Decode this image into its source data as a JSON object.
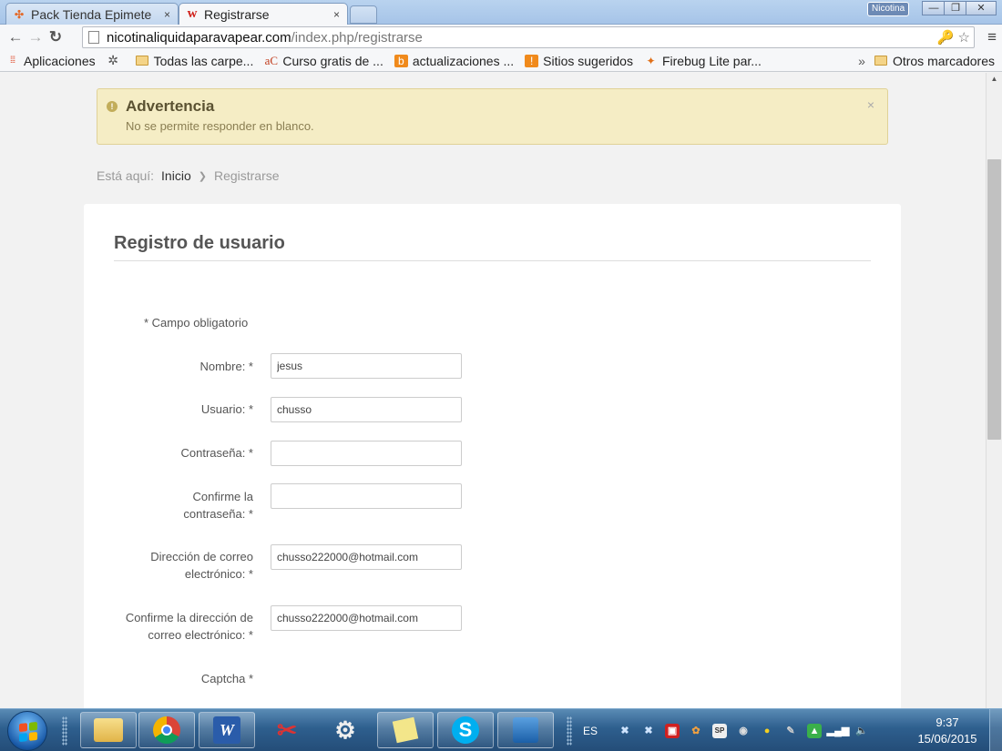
{
  "browser": {
    "tabs": [
      {
        "title": "Pack Tienda Epimete",
        "favicon": "joomla-icon",
        "active": false
      },
      {
        "title": "Registrarse",
        "favicon": "w-logo-icon",
        "active": true
      }
    ],
    "tab_close": "×",
    "profile_name": "Nicotina",
    "window_controls": {
      "minimize": "—",
      "maximize": "❐",
      "close": "✕"
    },
    "url_host": "nicotinaliquidaparavapear.com",
    "url_path": "/index.php/registrarse",
    "bookmarks": [
      {
        "label": "Aplicaciones",
        "icon": "apps-grid-icon"
      },
      {
        "label": "",
        "icon": "gear-icon"
      },
      {
        "label": "Todas las carpe...",
        "icon": "folder-icon"
      },
      {
        "label": "Curso gratis de ...",
        "icon": "ac-logo-icon"
      },
      {
        "label": "actualizaciones ...",
        "icon": "blogger-icon"
      },
      {
        "label": "Sitios sugeridos",
        "icon": "suggested-sites-icon"
      },
      {
        "label": "Firebug Lite par...",
        "icon": "firebug-icon"
      }
    ],
    "bookmarks_overflow": "»",
    "other_bookmarks": "Otros marcadores"
  },
  "alert": {
    "title": "Advertencia",
    "message": "No se permite responder en blanco.",
    "close": "×"
  },
  "breadcrumb": {
    "prefix": "Está aquí:",
    "home": "Inicio",
    "current": "Registrarse"
  },
  "form": {
    "heading": "Registro de usuario",
    "required_note": "* Campo obligatorio",
    "fields": [
      {
        "label": "Nombre: *",
        "value": "jesus"
      },
      {
        "label": "Usuario: *",
        "value": "chusso"
      },
      {
        "label": "Contraseña: *",
        "value": ""
      },
      {
        "label": "Confirme la contraseña: *",
        "value": ""
      },
      {
        "label": "Dirección de correo electrónico: *",
        "value": "chusso222000@hotmail.com"
      },
      {
        "label": "Confirme la dirección de correo electrónico: *",
        "value": "chusso222000@hotmail.com"
      }
    ],
    "captcha_label": "Captcha *"
  },
  "taskbar": {
    "apps": [
      "explorer-icon",
      "chrome-icon",
      "word-icon",
      "snipping-tool-icon",
      "settings-app-icon",
      "sticky-notes-icon",
      "skype-icon",
      "network-app-icon"
    ],
    "word_letter": "W",
    "skype_letter": "S",
    "language": "ES",
    "sp_badge": "SP",
    "time": "9:37",
    "date": "15/06/2015"
  }
}
